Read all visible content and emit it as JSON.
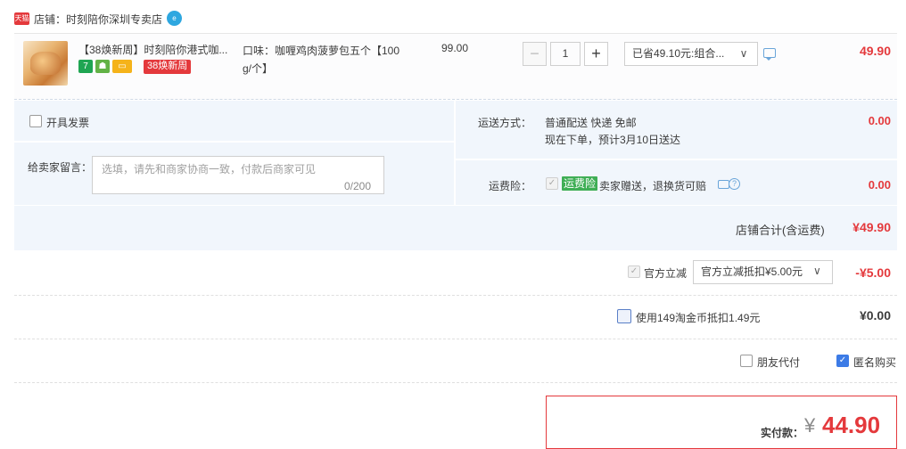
{
  "shop": {
    "badge": "天猫",
    "name": "店铺：时刻陪你深圳专卖店",
    "chat_badge": "e"
  },
  "item": {
    "title": "【38焕新周】时刻陪你港式咖...",
    "tag_seven": "7",
    "tag_promo": "38焕新周",
    "sku_line1": "口味：咖喱鸡肉菠萝包五个【100",
    "sku_line2": "g/个】",
    "unit_price": "99.00",
    "qty_minus": "−",
    "qty_value": "1",
    "qty_plus": "+",
    "promo_select": "已省49.10元:组合...",
    "promo_arrow": "∨",
    "total": "49.90"
  },
  "options": {
    "invoice_label": "开具发票",
    "message_label": "给卖家留言：",
    "message_placeholder": "选填，请先和商家协商一致，付款后商家可见",
    "message_count": "0/200",
    "shipping_label": "运送方式：",
    "shipping_line1": "普通配送 快递 免邮",
    "shipping_line2": "现在下单，预计3月10日送达",
    "shipping_fee": "0.00",
    "insurance_label": "运费险：",
    "insurance_tag": "运费险",
    "insurance_desc": "卖家赠送，退换货可赔",
    "insurance_help": "?",
    "insurance_fee": "0.00",
    "shop_total_label": "店铺合计(含运费)",
    "shop_total": "¥49.90"
  },
  "discounts": {
    "official_label": "官方立减",
    "official_select": "官方立减抵扣¥5.00元",
    "official_arrow": "∨",
    "official_amount": "-¥5.00",
    "coin_label": "使用149淘金币抵扣1.49元",
    "coin_amount": "¥0.00",
    "friend_pay_label": "朋友代付",
    "anonymous_label": "匿名购买"
  },
  "payment": {
    "label": "实付款：",
    "currency": "¥",
    "amount": "44.90"
  },
  "colors": {
    "accent_red": "#e4393c",
    "panel_blue": "#f1f6fc",
    "check_blue": "#3c7be6",
    "insurance_green": "#3fae55"
  }
}
